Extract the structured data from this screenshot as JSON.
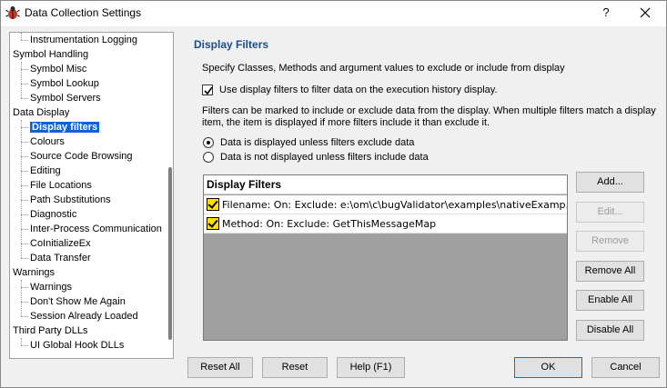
{
  "window": {
    "title": "Data Collection Settings",
    "help_label": "?",
    "close_label": "✕"
  },
  "tree": {
    "items": [
      {
        "label": "Instrumentation Logging",
        "level": 1
      },
      {
        "label": "Symbol Handling",
        "level": 0
      },
      {
        "label": "Symbol Misc",
        "level": 1
      },
      {
        "label": "Symbol Lookup",
        "level": 1
      },
      {
        "label": "Symbol Servers",
        "level": 1
      },
      {
        "label": "Data Display",
        "level": 0
      },
      {
        "label": "Display filters",
        "level": 1,
        "selected": true
      },
      {
        "label": "Colours",
        "level": 1
      },
      {
        "label": "Source Code Browsing",
        "level": 1
      },
      {
        "label": "Editing",
        "level": 1
      },
      {
        "label": "File Locations",
        "level": 1
      },
      {
        "label": "Path Substitutions",
        "level": 1
      },
      {
        "label": "Diagnostic",
        "level": 1
      },
      {
        "label": "Inter-Process Communication",
        "level": 1
      },
      {
        "label": "CoInitializeEx",
        "level": 1
      },
      {
        "label": "Data Transfer",
        "level": 1
      },
      {
        "label": "Warnings",
        "level": 0
      },
      {
        "label": "Warnings",
        "level": 1
      },
      {
        "label": "Don't Show Me Again",
        "level": 1
      },
      {
        "label": "Session Already Loaded",
        "level": 1
      },
      {
        "label": "Third Party DLLs",
        "level": 0
      },
      {
        "label": "UI Global Hook DLLs",
        "level": 1
      }
    ]
  },
  "content": {
    "heading": "Display Filters",
    "description": "Specify Classes, Methods and argument values to exclude or include from display",
    "use_filters_label": "Use display filters to filter data on the execution history display.",
    "use_filters_checked": true,
    "note": "Filters can be marked to include or exclude data from the display. When multiple filters match a display item, the item is displayed if more filters include it than exclude it.",
    "radio_unless_exclude": "Data is displayed unless filters exclude data",
    "radio_unless_include": "Data is not displayed unless filters include data",
    "list_header": "Display Filters",
    "filters": [
      {
        "text": "Filename: On:  Exclude: e:\\om\\c\\bugValidator\\examples\\nativeExamp...",
        "checked": true
      },
      {
        "text": "Method: On:  Exclude: GetThisMessageMap",
        "checked": true
      }
    ]
  },
  "buttons": {
    "add": "Add...",
    "edit": "Edit...",
    "remove": "Remove",
    "remove_all": "Remove All",
    "enable_all": "Enable All",
    "disable_all": "Disable All",
    "reset_all": "Reset All",
    "reset": "Reset",
    "help": "Help (F1)",
    "ok": "OK",
    "cancel": "Cancel"
  }
}
